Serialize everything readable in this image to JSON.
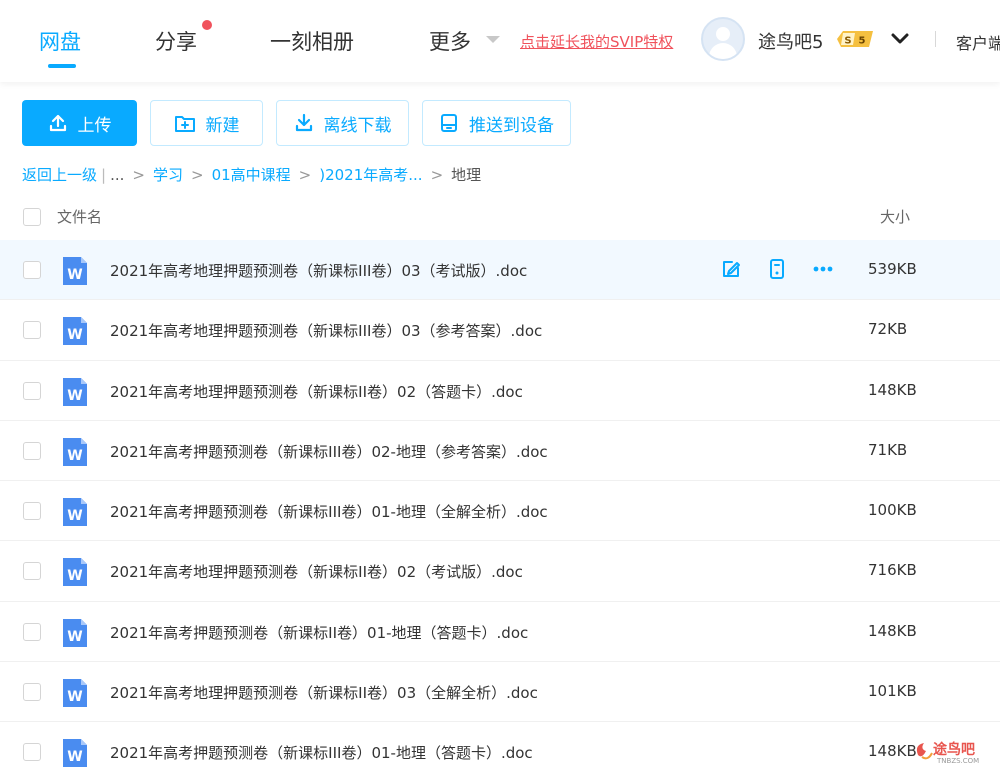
{
  "colors": {
    "accent": "#09aaff",
    "alert": "#f0525c",
    "badge": "#f5c040"
  },
  "nav": {
    "items": [
      "网盘",
      "分享",
      "一刻相册",
      "更多"
    ],
    "active": "网盘",
    "svip_link": "点击延长我的SVIP特权",
    "username": "途鸟吧5",
    "badge_level": "5",
    "client": "客户端"
  },
  "toolbar": {
    "upload": "上传",
    "new_folder": "新建",
    "offline_download": "离线下载",
    "push_to_device": "推送到设备"
  },
  "breadcrumb": {
    "back": "返回上一级",
    "ellipsis": "...",
    "items": [
      "学习",
      "01高中课程",
      ")2021年高考..."
    ],
    "current": "地理"
  },
  "list_header": {
    "name": "文件名",
    "size": "大小"
  },
  "files": [
    {
      "name": "2021年高考地理押题预测卷（新课标III卷）03（考试版）.doc",
      "size": "539KB",
      "icon": "word-doc-icon"
    },
    {
      "name": "2021年高考地理押题预测卷（新课标III卷）03（参考答案）.doc",
      "size": "72KB",
      "icon": "word-doc-icon"
    },
    {
      "name": "2021年高考地理押题预测卷（新课标II卷）02（答题卡）.doc",
      "size": "148KB",
      "icon": "word-doc-icon"
    },
    {
      "name": "2021年高考押题预测卷（新课标III卷）02-地理（参考答案）.doc",
      "size": "71KB",
      "icon": "word-doc-icon"
    },
    {
      "name": "2021年高考押题预测卷（新课标III卷）01-地理（全解全析）.doc",
      "size": "100KB",
      "icon": "word-doc-icon"
    },
    {
      "name": "2021年高考地理押题预测卷（新课标II卷）02（考试版）.doc",
      "size": "716KB",
      "icon": "word-doc-icon"
    },
    {
      "name": "2021年高考押题预测卷（新课标II卷）01-地理（答题卡）.doc",
      "size": "148KB",
      "icon": "word-doc-icon"
    },
    {
      "name": "2021年高考地理押题预测卷（新课标II卷）03（全解全析）.doc",
      "size": "101KB",
      "icon": "word-doc-icon"
    },
    {
      "name": "2021年高考押题预测卷（新课标III卷）01-地理（答题卡）.doc",
      "size": "148KB",
      "icon": "word-doc-icon"
    }
  ],
  "row_actions": [
    "rename-icon",
    "send-to-phone-icon",
    "more-options-icon"
  ],
  "watermark": {
    "text": "途鸟吧",
    "sub": "TNBZS.COM"
  }
}
